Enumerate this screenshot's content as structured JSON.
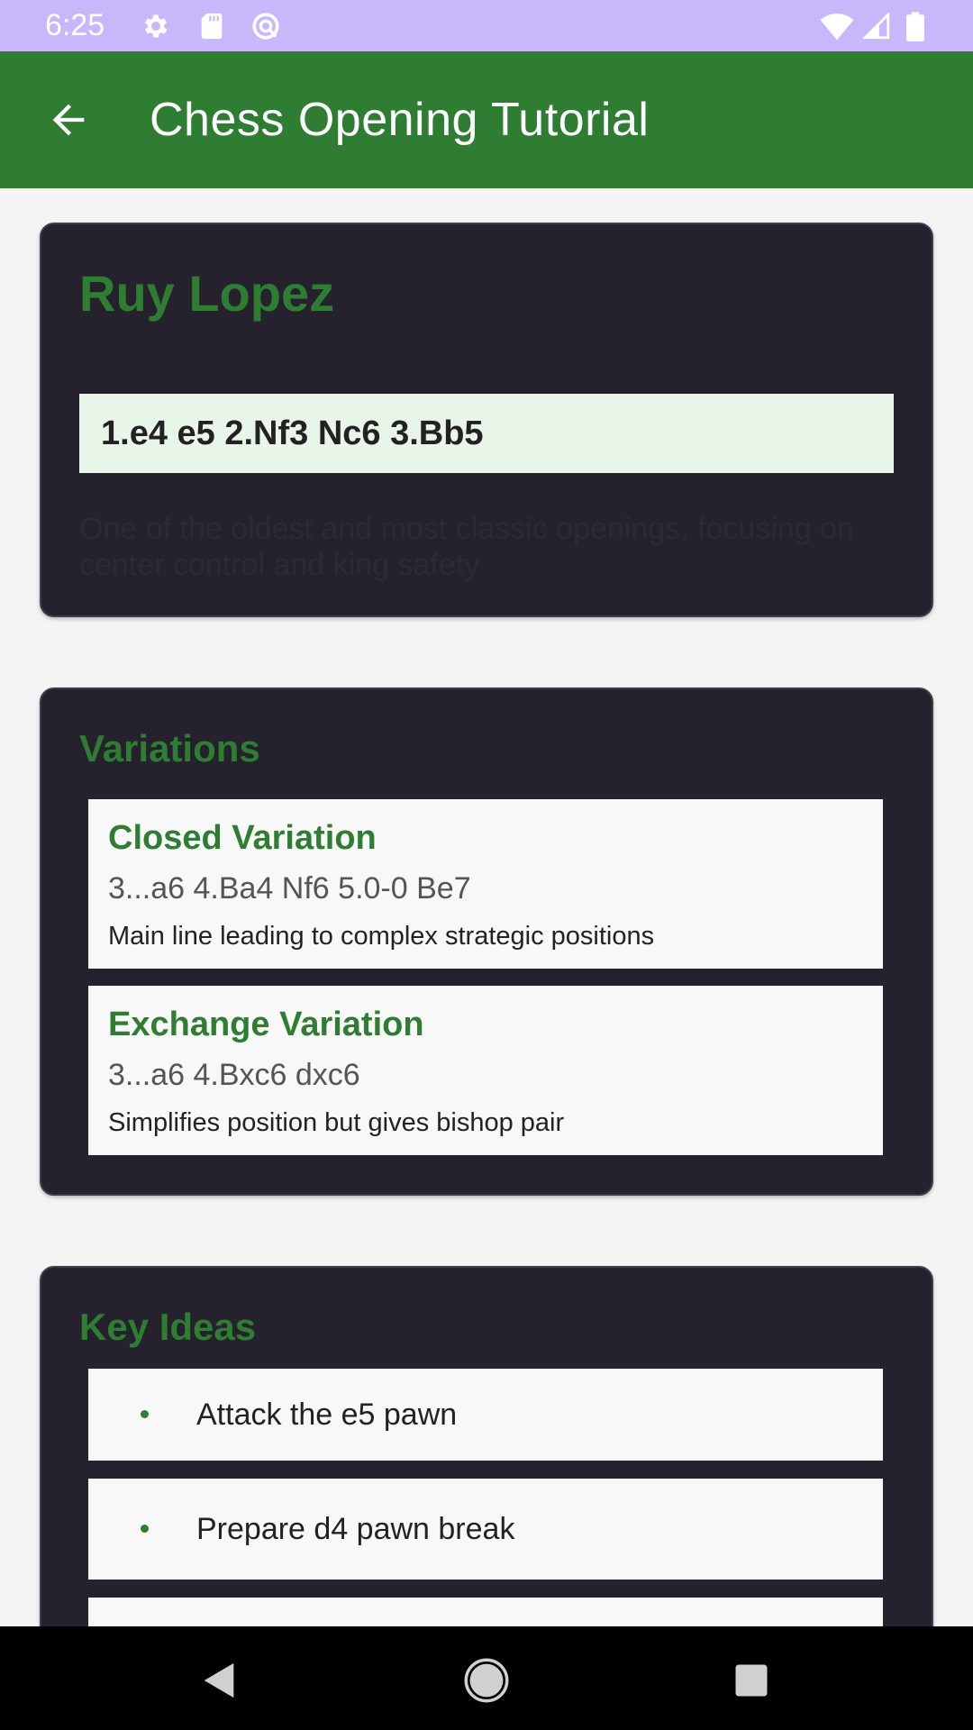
{
  "status_bar": {
    "time": "6:25",
    "icons": [
      "gear-icon",
      "sd-card-icon",
      "sync-icon",
      "wifi-icon",
      "signal-icon",
      "battery-icon"
    ]
  },
  "app_bar": {
    "title": "Chess Opening Tutorial",
    "back_icon": "arrow-back-icon"
  },
  "opening": {
    "name": "Ruy Lopez",
    "moves": "1.e4 e5 2.Nf3 Nc6 3.Bb5",
    "description": "One of the oldest and most classic openings, focusing on center control and king safety"
  },
  "variations": {
    "title": "Variations",
    "items": [
      {
        "name": "Closed Variation",
        "moves": "3...a6 4.Ba4 Nf6 5.0-0 Be7",
        "description": "Main line leading to complex strategic positions"
      },
      {
        "name": "Exchange Variation",
        "moves": "3...a6 4.Bxc6 dxc6",
        "description": "Simplifies position but gives bishop pair"
      }
    ]
  },
  "key_ideas": {
    "title": "Key Ideas",
    "items": [
      "Attack the e5 pawn",
      "Prepare d4 pawn break"
    ]
  },
  "nav_bar": {
    "buttons": [
      "back-triangle-icon",
      "home-circle-icon",
      "recents-square-icon"
    ]
  },
  "colors": {
    "status_bar": "#c6b8fb",
    "app_bar": "#2e7d32",
    "card_background": "#25222d",
    "accent_green": "#2e7d32",
    "moves_box": "#e8f5e9",
    "page_background": "#f4f4f4"
  }
}
